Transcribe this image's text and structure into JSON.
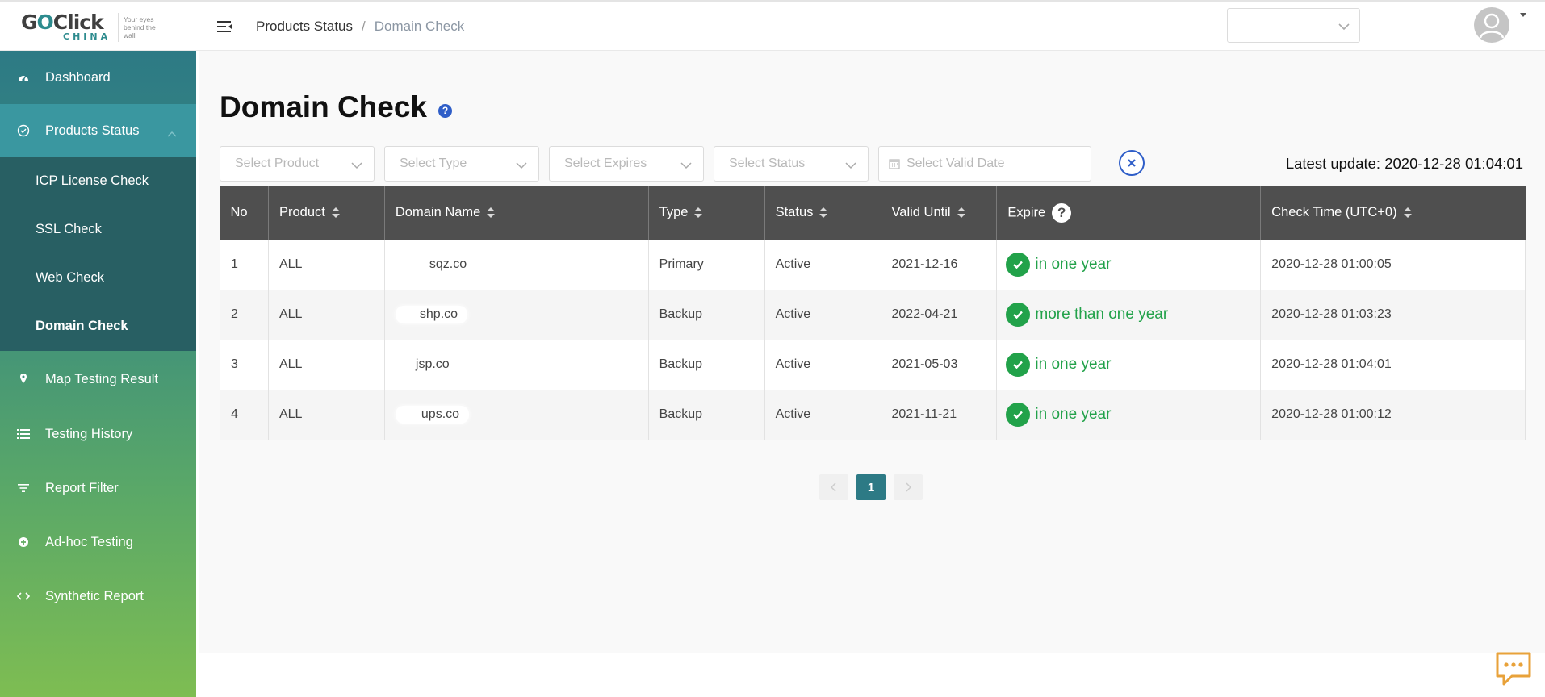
{
  "brand": {
    "logo_word_left": "G",
    "logo_word_oo": "O",
    "logo_word_right": "Click",
    "logo_sub": "CHINA",
    "tagline": "Your eyes behind the wall"
  },
  "header": {
    "breadcrumb": [
      "Products Status",
      "Domain Check"
    ],
    "breadcrumb_sep": "/",
    "select_value": ""
  },
  "sidebar": {
    "items": [
      {
        "label": "Dashboard",
        "icon": "dashboard-icon"
      },
      {
        "label": "Products Status",
        "icon": "check-circle-icon"
      },
      {
        "label": "Map Testing Result",
        "icon": "map-pin-icon"
      },
      {
        "label": "Testing History",
        "icon": "list-icon"
      },
      {
        "label": "Report Filter",
        "icon": "filter-icon"
      },
      {
        "label": "Ad-hoc Testing",
        "icon": "plus-circle-icon"
      },
      {
        "label": "Synthetic Report",
        "icon": "code-icon"
      }
    ],
    "sub_items": [
      {
        "label": "ICP License Check"
      },
      {
        "label": "SSL Check"
      },
      {
        "label": "Web Check"
      },
      {
        "label": "Domain Check",
        "active": true
      }
    ]
  },
  "page": {
    "title": "Domain Check",
    "help": "?",
    "latest_update": "Latest update: 2020-12-28 01:04:01"
  },
  "filters": {
    "product": "Select Product",
    "type": "Select Type",
    "expires": "Select Expires",
    "status": "Select Status",
    "valid_date": "Select Valid Date"
  },
  "table": {
    "headers": [
      "No",
      "Product",
      "Domain Name",
      "Type",
      "Status",
      "Valid Until",
      "Expire",
      "Check Time (UTC+0)"
    ],
    "expire_help": "?",
    "rows": [
      {
        "no": "1",
        "product": "ALL",
        "domain": "sqz.co",
        "type": "Primary",
        "status": "Active",
        "valid_until": "2021-12-16",
        "expire": "in one year",
        "check_time": "2020-12-28 01:00:05"
      },
      {
        "no": "2",
        "product": "ALL",
        "domain": "shp.co",
        "type": "Backup",
        "status": "Active",
        "valid_until": "2022-04-21",
        "expire": "more than one year",
        "check_time": "2020-12-28 01:03:23"
      },
      {
        "no": "3",
        "product": "ALL",
        "domain": "jsp.co",
        "type": "Backup",
        "status": "Active",
        "valid_until": "2021-05-03",
        "expire": "in one year",
        "check_time": "2020-12-28 01:04:01"
      },
      {
        "no": "4",
        "product": "ALL",
        "domain": "ups.co",
        "type": "Backup",
        "status": "Active",
        "valid_until": "2021-11-21",
        "expire": "in one year",
        "check_time": "2020-12-28 01:00:12"
      }
    ]
  },
  "pagination": {
    "current": "1"
  },
  "colors": {
    "accent": "#2d7a85",
    "success": "#22a24a",
    "help_blue": "#2f5ec8",
    "table_header": "#4f4f4f"
  }
}
